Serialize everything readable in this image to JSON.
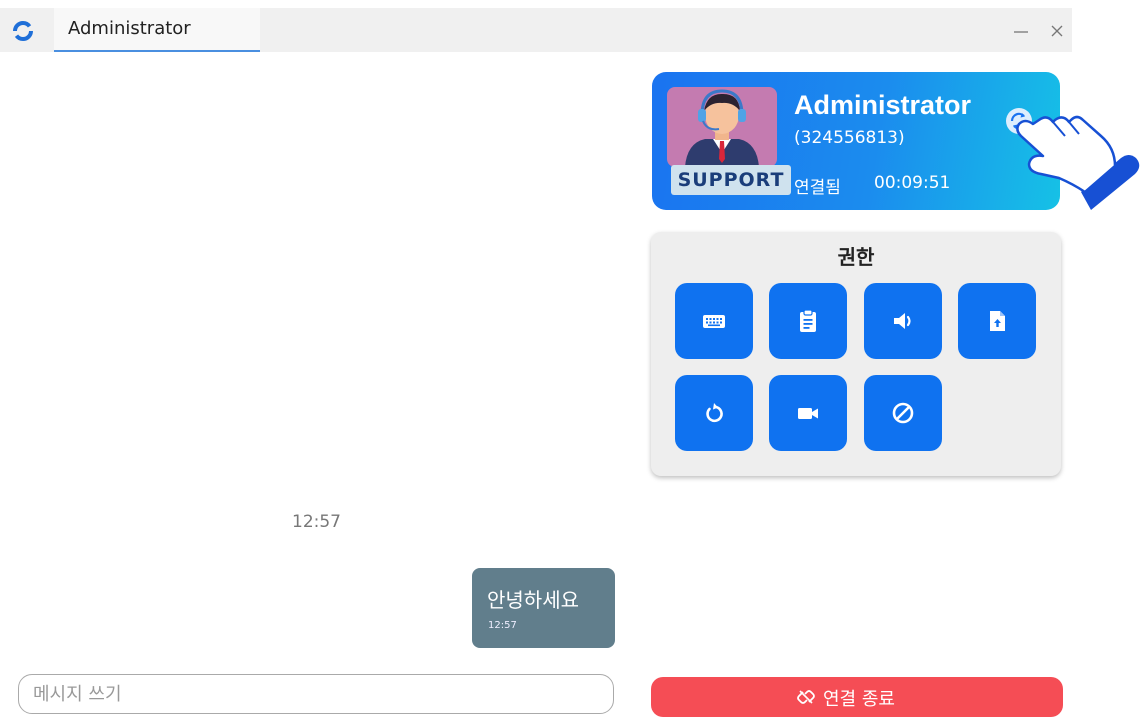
{
  "window": {
    "tab_title": "Administrator",
    "logo_icon": "app-logo-icon",
    "minimize_icon": "minimize-icon",
    "close_icon": "close-icon"
  },
  "profile": {
    "name": "Administrator",
    "id": "(324556813)",
    "status": "연결됨",
    "elapsed": "00:09:51",
    "avatar_label": "SUPPORT",
    "switch_icon": "switch-sides-icon",
    "colors": {
      "gradient_start": "#1a73f0",
      "gradient_end": "#16c1e6"
    }
  },
  "permissions": {
    "title": "권한",
    "buttons": [
      {
        "icon": "keyboard-icon"
      },
      {
        "icon": "clipboard-icon"
      },
      {
        "icon": "audio-icon"
      },
      {
        "icon": "file-transfer-icon"
      },
      {
        "icon": "restart-icon"
      },
      {
        "icon": "recording-icon"
      },
      {
        "icon": "block-input-icon"
      }
    ],
    "button_color": "#0f72f0"
  },
  "chat": {
    "date_time": "12:57",
    "messages": [
      {
        "text": "안녕하세요",
        "time": "12:57"
      }
    ],
    "input_placeholder": "메시지 쓰기"
  },
  "end_button": {
    "label": "연결 종료",
    "icon": "disconnect-icon",
    "color": "#f54d55"
  }
}
